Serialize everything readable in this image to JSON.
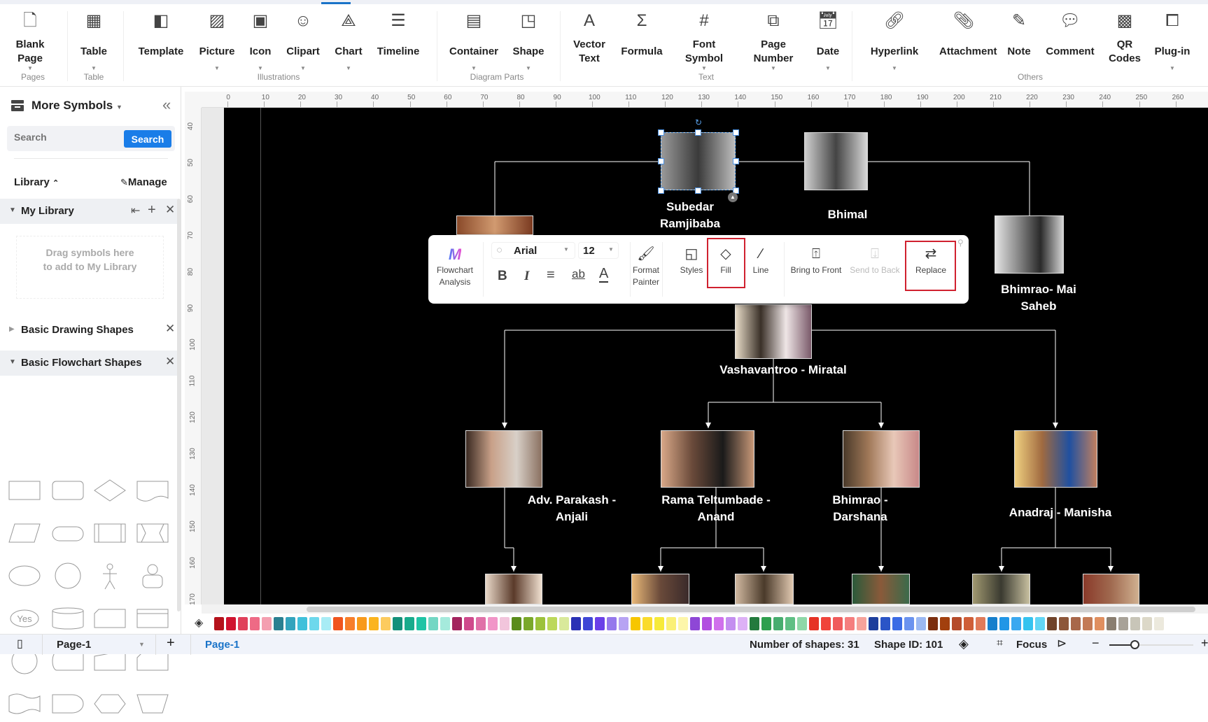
{
  "ribbon": {
    "items": [
      {
        "label": "Blank Page",
        "icon": "blank-page-icon",
        "caret": true
      },
      {
        "label": "Table",
        "icon": "table-icon",
        "caret": true
      },
      {
        "label": "Template",
        "icon": "template-icon",
        "caret": false
      },
      {
        "label": "Picture",
        "icon": "picture-icon",
        "caret": true
      },
      {
        "label": "Icon",
        "icon": "icon-icon",
        "caret": true
      },
      {
        "label": "Clipart",
        "icon": "clipart-icon",
        "caret": true
      },
      {
        "label": "Chart",
        "icon": "chart-icon",
        "caret": true
      },
      {
        "label": "Timeline",
        "icon": "timeline-icon",
        "caret": false
      },
      {
        "label": "Container",
        "icon": "container-icon",
        "caret": true
      },
      {
        "label": "Shape",
        "icon": "shape-icon",
        "caret": true
      },
      {
        "label": "Vector Text",
        "icon": "vector-text-icon",
        "caret": false
      },
      {
        "label": "Formula",
        "icon": "formula-icon",
        "caret": false
      },
      {
        "label": "Font Symbol",
        "icon": "font-symbol-icon",
        "caret": true
      },
      {
        "label": "Page Number",
        "icon": "page-number-icon",
        "caret": true
      },
      {
        "label": "Date",
        "icon": "date-icon",
        "caret": true
      },
      {
        "label": "Hyperlink",
        "icon": "hyperlink-icon",
        "caret": true
      },
      {
        "label": "Attachment",
        "icon": "attachment-icon",
        "caret": false
      },
      {
        "label": "Note",
        "icon": "note-icon",
        "caret": false
      },
      {
        "label": "Comment",
        "icon": "comment-icon",
        "caret": false
      },
      {
        "label": "QR Codes",
        "icon": "qr-codes-icon",
        "caret": false
      },
      {
        "label": "Plug-in",
        "icon": "plug-in-icon",
        "caret": true
      }
    ],
    "groups": [
      "Pages",
      "Table",
      "Illustrations",
      "Diagram Parts",
      "Text",
      "Others"
    ]
  },
  "sidebar": {
    "title": "More Symbols",
    "search_placeholder": "Search",
    "search_button": "Search",
    "library_label": "Library",
    "manage_label": "Manage",
    "my_library": "My Library",
    "drop_hint": "Drag symbols here to add to My Library",
    "sections": [
      "Basic Drawing Shapes",
      "Basic Flowchart Shapes"
    ],
    "yes_shape_label": "Yes"
  },
  "ruler": {
    "h": [
      "0",
      "10",
      "20",
      "30",
      "40",
      "50",
      "60",
      "70",
      "80",
      "90",
      "100",
      "110",
      "120",
      "130",
      "140",
      "150",
      "160",
      "170",
      "180",
      "190",
      "200",
      "210",
      "220",
      "230",
      "240",
      "250",
      "260"
    ],
    "v": [
      "40",
      "50",
      "60",
      "70",
      "80",
      "90",
      "100",
      "110",
      "120",
      "130",
      "140",
      "150",
      "160",
      "170"
    ]
  },
  "diagram": {
    "names": {
      "subedar": "Subedar Ramjibaba",
      "bhimal": "Bhimal",
      "bhimrao_mai": "Bhimrao- Mai Saheb",
      "vashavantroo": "Vashavantroo - Miratal",
      "parakash": "Adv. Parakash - Anjali",
      "rama": "Rama Teltumbade - Anand",
      "darshana": "Bhimrao - Darshana",
      "anadraj": "Anadraj - Manisha"
    }
  },
  "floating_toolbar": {
    "flowchart_analysis": "Flowchart Analysis",
    "font": "Arial",
    "font_size": "12",
    "format_painter": "Format Painter",
    "styles": "Styles",
    "fill": "Fill",
    "line": "Line",
    "bring_to_front": "Bring to Front",
    "send_to_back": "Send to Back",
    "replace": "Replace"
  },
  "palette": [
    "#b5121b",
    "#d0132f",
    "#e0405a",
    "#ee6a85",
    "#f49fb0",
    "#2a8091",
    "#33a4bd",
    "#3fc0da",
    "#6dd8ec",
    "#a8ecf5",
    "#f0551f",
    "#f77e2b",
    "#f89a1c",
    "#fbb41e",
    "#fccb5e",
    "#13907a",
    "#18ab8c",
    "#1fc4a5",
    "#73d7c4",
    "#a5eadc",
    "#a3245e",
    "#cf4a8c",
    "#e070a8",
    "#f195c8",
    "#f2c5dc",
    "#5a8c1c",
    "#7aa82a",
    "#9cc23a",
    "#bcd85a",
    "#d9e99b",
    "#2a31b5",
    "#3f47d6",
    "#6a3fe8",
    "#9578ec",
    "#b7a3f3",
    "#f7c600",
    "#fadb2c",
    "#f6ea3a",
    "#faf077",
    "#fdf6aa",
    "#8e47d6",
    "#b24ee0",
    "#d070ec",
    "#c48ef0",
    "#ddb1f6",
    "#237a3d",
    "#2f9f4e",
    "#47ad6f",
    "#5fbf84",
    "#8fd8a8",
    "#e63225",
    "#f0443b",
    "#f05b5b",
    "#f57e7e",
    "#f6a39b",
    "#1d3e9c",
    "#2a55c7",
    "#3a6be5",
    "#6b93ef",
    "#9bb9f3",
    "#7c2f0f",
    "#a2400e",
    "#b54b2a",
    "#cf5e38",
    "#e07a59",
    "#167fcc",
    "#2196e6",
    "#3aa8f0",
    "#35c3ef",
    "#62d6f5",
    "#70432a",
    "#8d573a",
    "#a8674a",
    "#c37a55",
    "#e08f5f",
    "#8a7e70",
    "#a8a298",
    "#c8c5b8",
    "#dcd8c8",
    "#ece9dd"
  ],
  "status": {
    "page_dropdown": "Page-1",
    "active_tab": "Page-1",
    "shapes_count": "Number of shapes: 31",
    "shape_id": "Shape ID: 101",
    "focus": "Focus",
    "zoom_level": 0.3
  }
}
